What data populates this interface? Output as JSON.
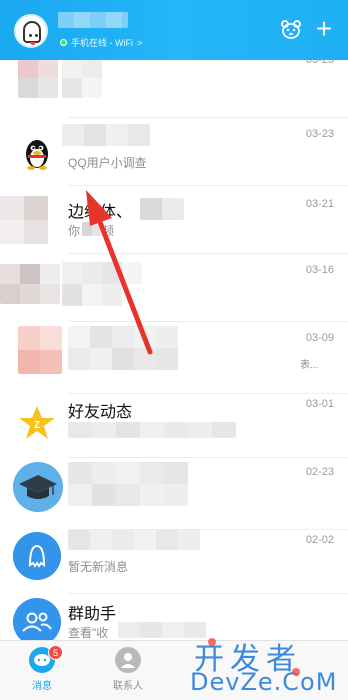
{
  "header": {
    "status_text": "手机在线 - WiFi",
    "status_chevron": ">",
    "plus_label": "+",
    "icons": [
      "avatar",
      "bear-icon",
      "plus-icon"
    ],
    "brand_color": "#1fb0f4"
  },
  "chats": [
    {
      "name": "",
      "preview": "",
      "time": "03-23"
    },
    {
      "name": "",
      "preview": "QQ用户小调查",
      "time": "03-23"
    },
    {
      "name": "边缘体、",
      "preview": "你",
      "preview_end": "频",
      "time": "03-21"
    },
    {
      "name": "",
      "preview": "",
      "time": "03-16"
    },
    {
      "name": "",
      "preview": "",
      "time": "03-09",
      "trail": "表..."
    },
    {
      "name": "好友动态",
      "preview": "",
      "time": "03-01"
    },
    {
      "name": "",
      "preview": "",
      "time": "02-23"
    },
    {
      "name": "",
      "preview": "暂无新消息",
      "time": "02-02"
    },
    {
      "name": "群助手",
      "preview": "查看\"收",
      "time": ""
    }
  ],
  "tabbar": {
    "messages_label": "消息",
    "contacts_label": "联系人",
    "badge_count": "5",
    "active_color": "#1aa8f0"
  },
  "watermark": {
    "line1": "开发者",
    "line2": "DevZe.CoM"
  }
}
